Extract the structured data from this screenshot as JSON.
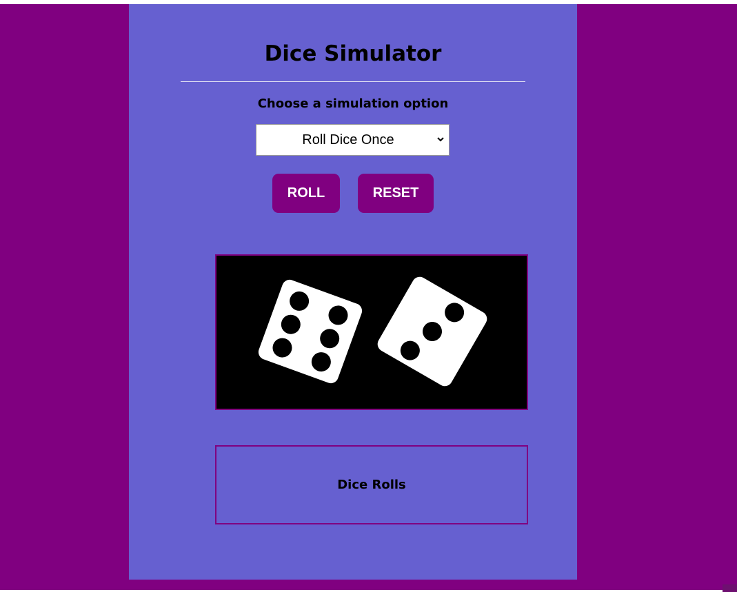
{
  "app": {
    "title": "Dice Simulator",
    "subtitle": "Choose a simulation option"
  },
  "simulation_select": {
    "selected": "Roll Dice Once"
  },
  "buttons": {
    "roll_label": "ROLL",
    "reset_label": "RESET"
  },
  "dice_display": {
    "dice": [
      {
        "value": 6,
        "icon": "die-face-6-icon"
      },
      {
        "value": 3,
        "icon": "die-face-3-icon"
      }
    ]
  },
  "rolls_panel": {
    "title": "Dice Rolls"
  },
  "colors": {
    "page_background": "#800080",
    "panel_background": "#6660d0",
    "button_background": "#800080",
    "dice_background": "#000000",
    "die_face": "#ffffff",
    "pip": "#000000"
  }
}
